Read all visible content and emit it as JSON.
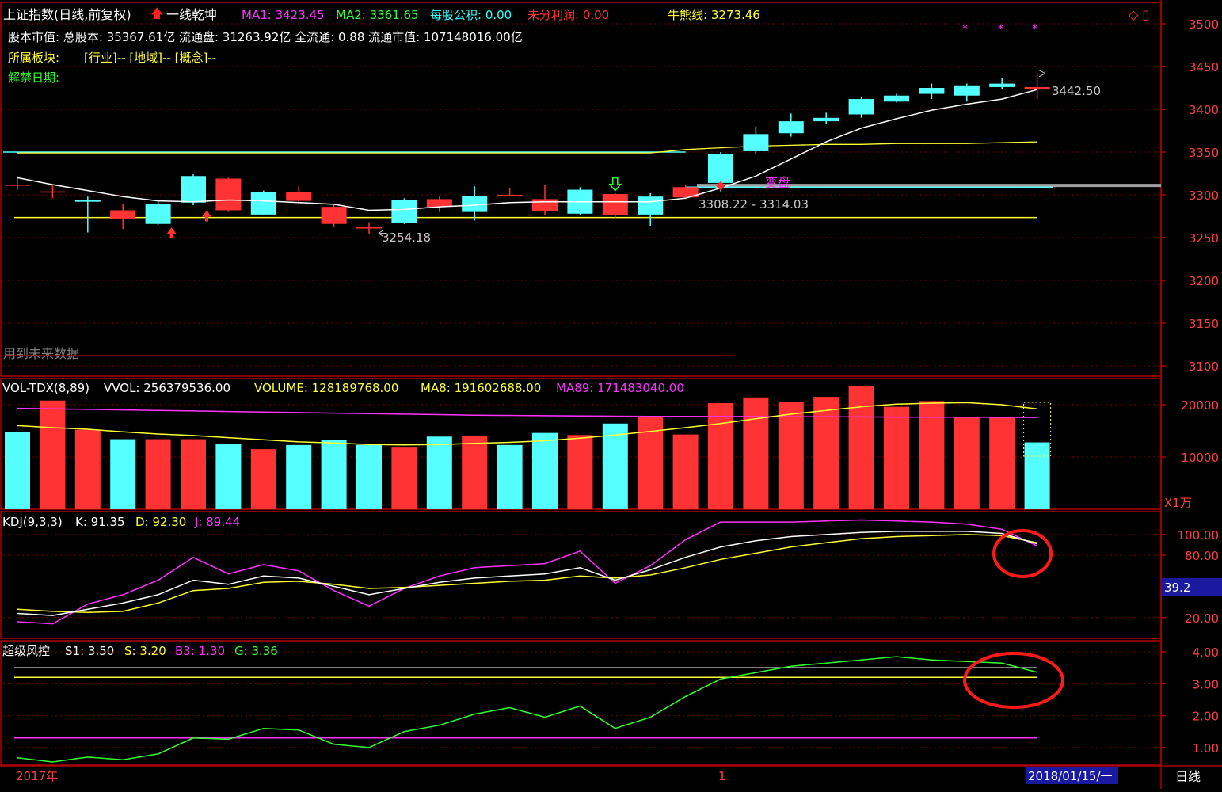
{
  "colors": {
    "bg": "#000000",
    "frame": "#b00000",
    "up": "#ff3333",
    "down": "#54ffff",
    "white": "#ffffff",
    "yellow": "#ffff33",
    "magenta": "#ff33ff",
    "green": "#33ff33",
    "axisText": "#ff4040",
    "gray": "#a0a0a0",
    "circle": "#ff1a1a"
  },
  "header": {
    "title": "上证指数(日线,前复权)",
    "strategy": "一线乾坤",
    "ma1_label": "MA1: 3423.45",
    "ma2_label": "MA2: 3361.65",
    "gongji_label": "每股公积: 0.00",
    "lirun_label": "未分利润: 0.00",
    "niuxiong_label": "牛熊线: 3273.46",
    "line2": "股本市值: 总股本: 35367.61亿 流通盘: 31263.92亿 全流通: 0.88 流通市值:  107148016.00亿",
    "bankuai_label": "所属板块:",
    "bankuai_value": "[行业]-- [地域]-- [概念]--",
    "jiejin_label": "解禁日期:",
    "future_note": "用到未来数据",
    "corner_icons": "◇ ▯",
    "stars": [
      "*",
      "*",
      "*"
    ]
  },
  "annotations": {
    "low": "3254.18",
    "high": "3442.50",
    "range": "3308.22 - 3314.03",
    "biangpan": "变盘"
  },
  "vol_header": {
    "name": "VOL-TDX(8,89)",
    "vvol": "VVOL: 256379536.00",
    "volume": "VOLUME: 128189768.00",
    "ma8": "MA8: 191602688.00",
    "ma89": "MA89: 171483040.00",
    "unit": "X1万"
  },
  "kdj_header": {
    "name": "KDJ(9,3,3)",
    "k": "K: 91.35",
    "d": "D: 92.30",
    "j": "J: 89.44",
    "cursor_value": "39.2"
  },
  "risk_header": {
    "name": "超级风控",
    "s1": "S1: 3.50",
    "s": "S: 3.20",
    "b3": "B3: 1.30",
    "g": "G: 3.36"
  },
  "footer": {
    "year": "2017年",
    "marker": "1",
    "date": "2018/01/15/一",
    "period": "日线"
  },
  "chart_data": [
    {
      "type": "candlestick",
      "y_ticks": [
        3100,
        3150,
        3200,
        3250,
        3300,
        3350,
        3400,
        3450,
        3500
      ],
      "ylim": [
        3088,
        3525
      ],
      "candles": [
        {
          "o": 3312,
          "h": 3322,
          "l": 3306,
          "c": 3312
        },
        {
          "o": 3304,
          "h": 3312,
          "l": 3296,
          "c": 3304
        },
        {
          "o": 3294,
          "h": 3298,
          "l": 3256,
          "c": 3292
        },
        {
          "o": 3272,
          "h": 3289,
          "l": 3260,
          "c": 3282
        },
        {
          "o": 3289,
          "h": 3292,
          "l": 3265,
          "c": 3266
        },
        {
          "o": 3322,
          "h": 3324,
          "l": 3288,
          "c": 3291
        },
        {
          "o": 3282,
          "h": 3320,
          "l": 3280,
          "c": 3319
        },
        {
          "o": 3303,
          "h": 3305,
          "l": 3276,
          "c": 3277
        },
        {
          "o": 3293,
          "h": 3310,
          "l": 3290,
          "c": 3303
        },
        {
          "o": 3266,
          "h": 3288,
          "l": 3262,
          "c": 3286
        },
        {
          "o": 3262,
          "h": 3268,
          "l": 3254,
          "c": 3262
        },
        {
          "o": 3294,
          "h": 3296,
          "l": 3266,
          "c": 3267
        },
        {
          "o": 3286,
          "h": 3298,
          "l": 3280,
          "c": 3295
        },
        {
          "o": 3299,
          "h": 3310,
          "l": 3270,
          "c": 3280
        },
        {
          "o": 3300,
          "h": 3308,
          "l": 3298,
          "c": 3300
        },
        {
          "o": 3281,
          "h": 3312,
          "l": 3276,
          "c": 3295
        },
        {
          "o": 3306,
          "h": 3309,
          "l": 3277,
          "c": 3278
        },
        {
          "o": 3276,
          "h": 3302,
          "l": 3273,
          "c": 3301
        },
        {
          "o": 3298,
          "h": 3302,
          "l": 3264,
          "c": 3277
        },
        {
          "o": 3297,
          "h": 3312,
          "l": 3295,
          "c": 3309
        },
        {
          "o": 3348,
          "h": 3350,
          "l": 3304,
          "c": 3314
        },
        {
          "o": 3371,
          "h": 3380,
          "l": 3348,
          "c": 3351
        },
        {
          "o": 3386,
          "h": 3395,
          "l": 3368,
          "c": 3372
        },
        {
          "o": 3390,
          "h": 3396,
          "l": 3383,
          "c": 3386
        },
        {
          "o": 3412,
          "h": 3414,
          "l": 3390,
          "c": 3394
        },
        {
          "o": 3416,
          "h": 3418,
          "l": 3408,
          "c": 3409
        },
        {
          "o": 3425,
          "h": 3430,
          "l": 3412,
          "c": 3418
        },
        {
          "o": 3428,
          "h": 3430,
          "l": 3409,
          "c": 3416
        },
        {
          "o": 3430,
          "h": 3437,
          "l": 3424,
          "c": 3426
        },
        {
          "o": 3423,
          "h": 3442.5,
          "l": 3412,
          "c": 3426
        }
      ],
      "ma_white": [
        3320,
        3312,
        3305,
        3298,
        3293,
        3292,
        3294,
        3293,
        3291,
        3289,
        3282,
        3283,
        3286,
        3288,
        3291,
        3292,
        3292,
        3292,
        3292,
        3296,
        3308,
        3322,
        3342,
        3362,
        3378,
        3389,
        3399,
        3406,
        3412,
        3423
      ],
      "yellow_line": {
        "value": 3273.46,
        "from": 0,
        "to": 29
      },
      "yellow_upper": [
        3349,
        3349,
        3349,
        3349,
        3349,
        3349,
        3349,
        3349,
        3349,
        3349,
        3349,
        3349,
        3349,
        3349,
        3349,
        3349,
        3349,
        3349,
        3349,
        3353,
        3355,
        3357,
        3358,
        3359,
        3359,
        3360,
        3360,
        3360,
        3361,
        3362
      ],
      "cyan_line": {
        "value": 3350,
        "from": 0,
        "to": 19
      },
      "cyan_band": {
        "value": 3309,
        "from": 19,
        "to": 29
      },
      "gray_band": {
        "value": 3311,
        "from": 20,
        "to": 32
      }
    },
    {
      "type": "bar",
      "y_ticks": [
        10000,
        20000
      ],
      "ylim": [
        0,
        25000
      ],
      "values": [
        14800,
        20800,
        15200,
        13400,
        13400,
        13400,
        12500,
        11500,
        12300,
        13300,
        12300,
        11800,
        13900,
        14100,
        12300,
        14600,
        14200,
        16400,
        17700,
        14300,
        20300,
        21400,
        20600,
        21500,
        23500,
        19600,
        20700,
        17700,
        17500,
        12800
      ],
      "up": [
        false,
        true,
        true,
        false,
        true,
        true,
        false,
        true,
        false,
        false,
        false,
        true,
        false,
        true,
        false,
        false,
        true,
        false,
        true,
        true,
        true,
        true,
        true,
        true,
        true,
        true,
        true,
        true,
        true,
        false
      ],
      "ma8": [
        16000,
        15600,
        15300,
        14800,
        14400,
        14100,
        13700,
        13300,
        12900,
        12700,
        12400,
        12300,
        12400,
        12600,
        12800,
        13100,
        13600,
        14200,
        14900,
        15600,
        16400,
        17300,
        18200,
        18900,
        19600,
        20100,
        20300,
        20400,
        20000,
        19200
      ],
      "ma89": [
        19300,
        19200,
        19100,
        19000,
        18900,
        18800,
        18700,
        18600,
        18500,
        18400,
        18300,
        18200,
        18100,
        18000,
        17950,
        17900,
        17850,
        17800,
        17780,
        17760,
        17740,
        17720,
        17700,
        17680,
        17660,
        17640,
        17620,
        17600,
        17580,
        17560
      ]
    },
    {
      "type": "line",
      "y_ticks": [
        20,
        80,
        100
      ],
      "ylim": [
        0,
        122
      ],
      "K": [
        24,
        22,
        28,
        34,
        42,
        56,
        52,
        60,
        58,
        50,
        42,
        48,
        54,
        58,
        60,
        62,
        68,
        56,
        66,
        78,
        88,
        94,
        98,
        100,
        102,
        103,
        103,
        103,
        101,
        91
      ],
      "D": [
        28,
        26,
        25,
        26,
        34,
        46,
        48,
        54,
        55,
        52,
        48,
        49,
        51,
        53,
        55,
        56,
        60,
        58,
        61,
        68,
        76,
        82,
        88,
        92,
        96,
        98,
        99,
        100,
        99,
        92
      ],
      "J": [
        16,
        14,
        33,
        42,
        56,
        78,
        62,
        71,
        65,
        46,
        31,
        48,
        60,
        68,
        70,
        72,
        84,
        53,
        70,
        95,
        112,
        112,
        112,
        113,
        114,
        113,
        112,
        110,
        105,
        89
      ]
    },
    {
      "type": "line",
      "y_ticks": [
        1,
        2,
        3,
        4
      ],
      "ylim": [
        0.45,
        4.35
      ],
      "S1": 3.5,
      "S": 3.2,
      "B3": 1.3,
      "G": [
        0.68,
        0.55,
        0.7,
        0.62,
        0.8,
        1.3,
        1.26,
        1.6,
        1.55,
        1.1,
        1.0,
        1.5,
        1.7,
        2.05,
        2.25,
        1.95,
        2.3,
        1.6,
        1.95,
        2.6,
        3.15,
        3.35,
        3.55,
        3.65,
        3.75,
        3.85,
        3.75,
        3.7,
        3.65,
        3.36
      ]
    }
  ]
}
